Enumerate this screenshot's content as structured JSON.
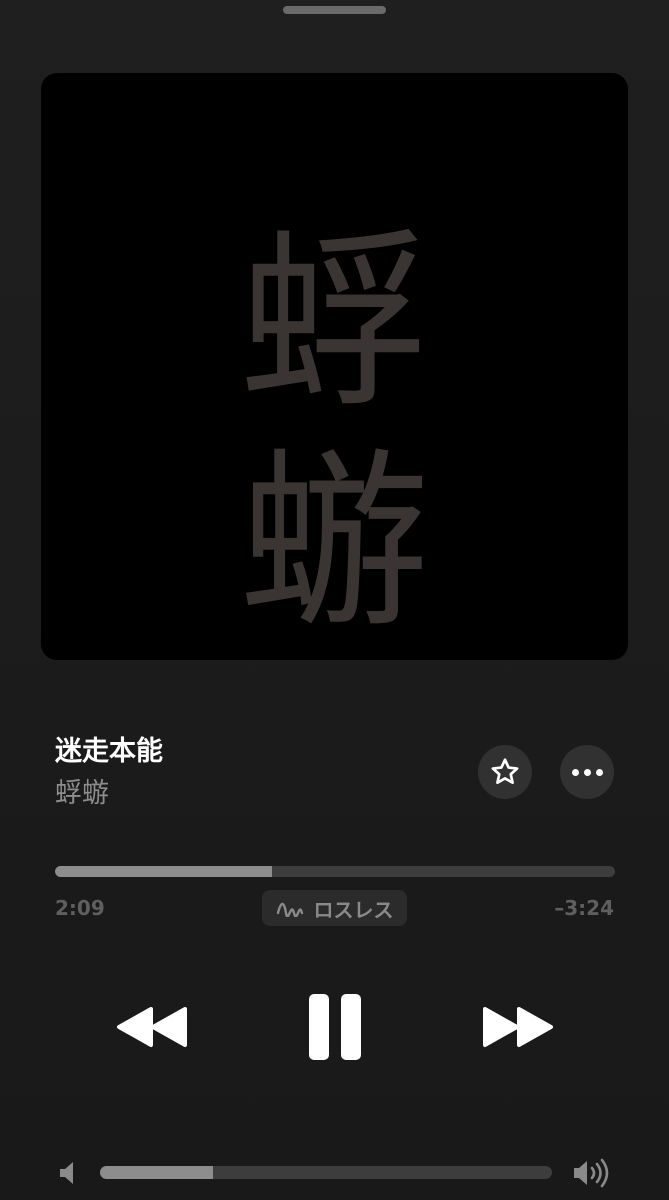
{
  "artwork": {
    "line1": "蜉",
    "line2": "蝣"
  },
  "track": {
    "title": "迷走本能",
    "artist": "蜉蝣"
  },
  "playback": {
    "elapsed": "2:09",
    "remaining": "–3:24",
    "progress_fraction": 0.387,
    "quality_label": "ロスレス",
    "state": "playing"
  },
  "volume": {
    "level_fraction": 0.25
  },
  "icons": {
    "favorite": "star-icon",
    "more": "more-dots-icon",
    "rewind": "rewind-icon",
    "pause": "pause-icon",
    "forward": "fast-forward-icon",
    "lossless": "lossless-wave-icon",
    "volume_low": "speaker-low-icon",
    "volume_high": "speaker-high-icon"
  },
  "colors": {
    "background": "#1c1c1c",
    "artwork_text": "#3a3433",
    "accent": "#ffffff"
  }
}
